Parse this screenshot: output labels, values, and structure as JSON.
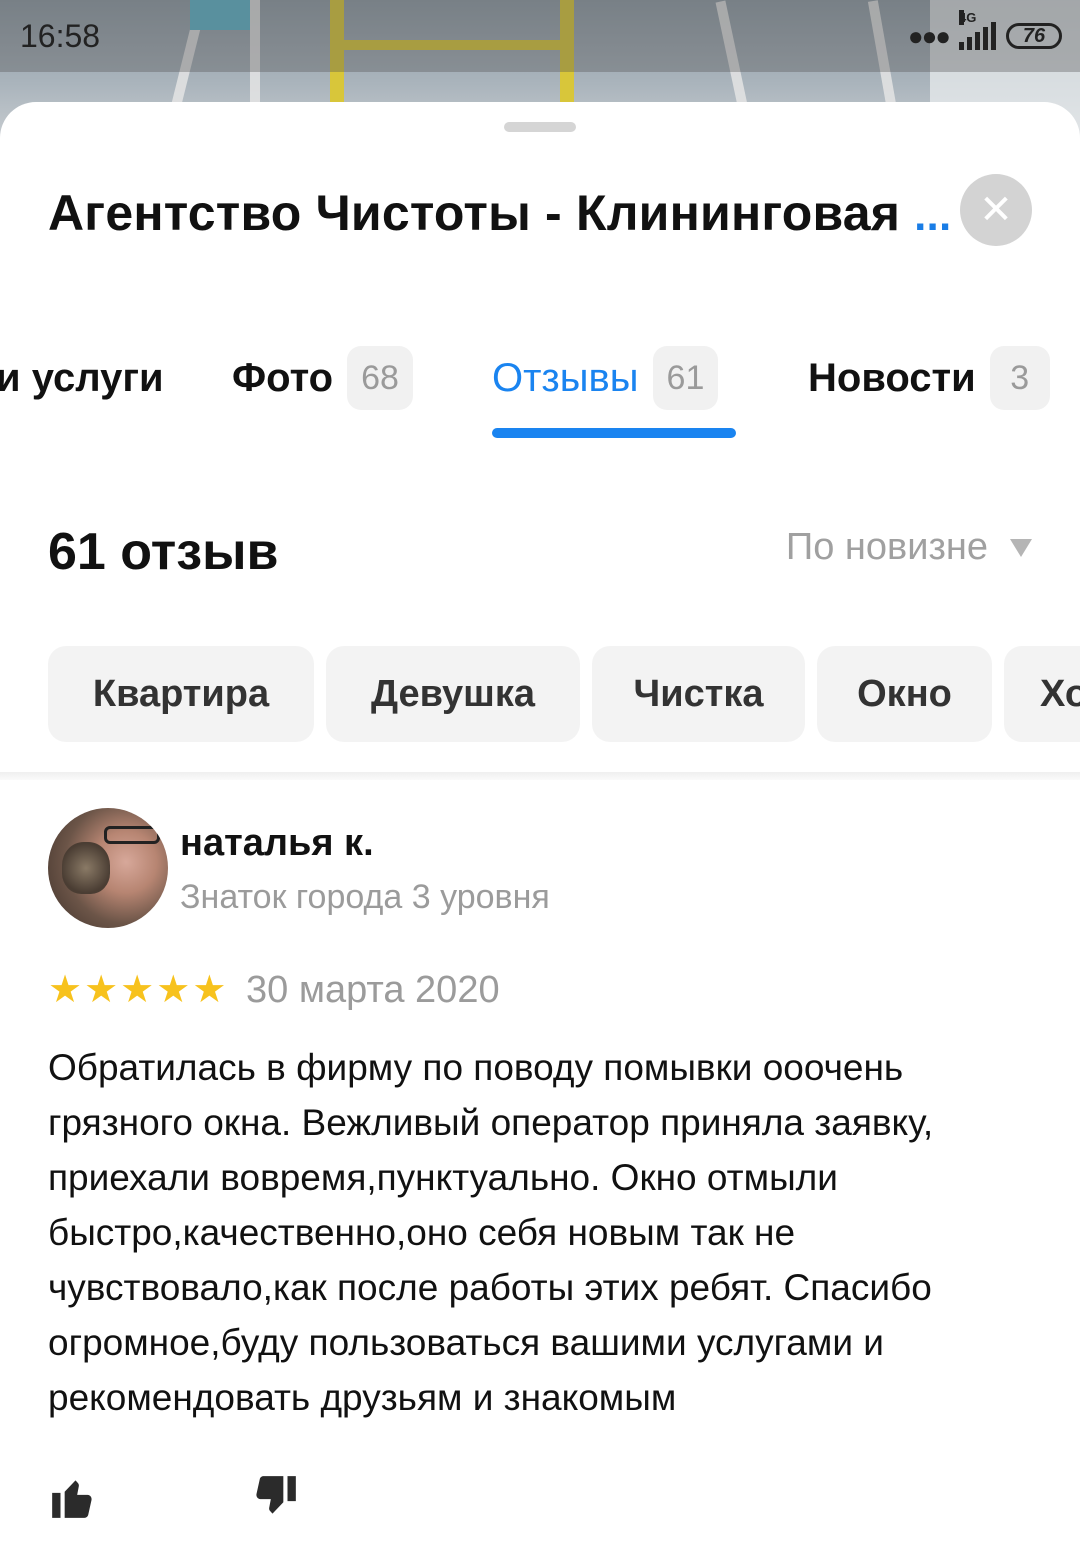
{
  "statusbar": {
    "time": "16:58",
    "network": "4G",
    "battery": "76"
  },
  "header": {
    "title": "Агентство Чистоты - Клининговая",
    "title_more": "...",
    "close_icon": "close-icon"
  },
  "tabs": [
    {
      "label": "и услуги",
      "badge": ""
    },
    {
      "label": "Фото",
      "badge": "68"
    },
    {
      "label": "Отзывы",
      "badge": "61",
      "active": true
    },
    {
      "label": "Новости",
      "badge": "3"
    }
  ],
  "reviews": {
    "count_label": "61 отзыв",
    "sort_label": "По новизне"
  },
  "chips": [
    "Квартира",
    "Девушка",
    "Чистка",
    "Окно",
    "Хо"
  ],
  "review": {
    "author": "наталья к.",
    "level": "Знаток города 3 уровня",
    "rating": 5,
    "date": "30 марта 2020",
    "text": "Обратилась в фирму по поводу помывки ооочень грязного окна. Вежливый оператор приняла заявку, приехали вовремя,пунктуально. Окно отмыли быстро,качественно,оно себя новым так не чувствовало,как после работы этих ребят. Спасибо огромное,буду пользоваться вашими услугами и рекомендовать друзьям и знакомым"
  },
  "colors": {
    "accent": "#1a84f0",
    "star": "#f7c21d",
    "muted": "#9b9b9b"
  }
}
